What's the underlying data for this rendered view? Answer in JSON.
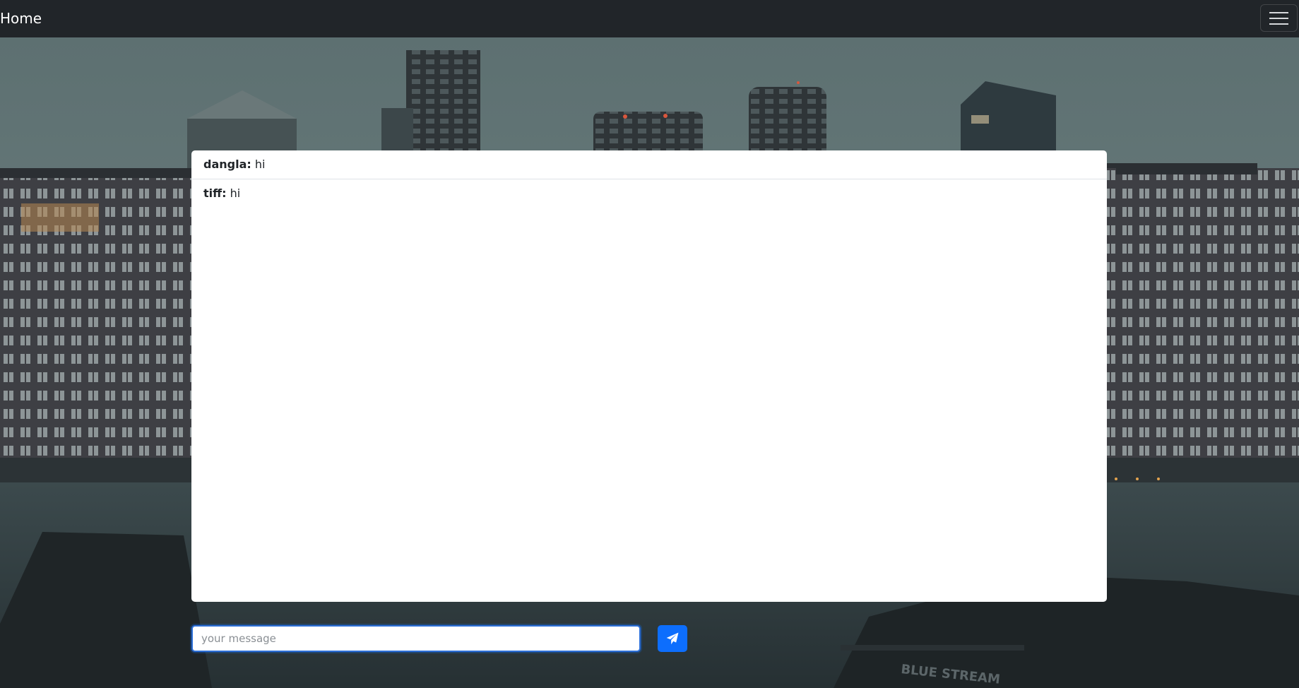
{
  "navbar": {
    "brand": "Home",
    "menu_icon": "hamburger-menu-icon"
  },
  "chat": {
    "messages": [
      {
        "user": "dangla:",
        "text": "hi"
      },
      {
        "user": "tiff:",
        "text": "hi"
      }
    ]
  },
  "composer": {
    "placeholder": "your message",
    "value": "",
    "send_icon": "paper-plane-icon"
  },
  "colors": {
    "navbar_bg": "#212529",
    "accent": "#0d6efd"
  }
}
